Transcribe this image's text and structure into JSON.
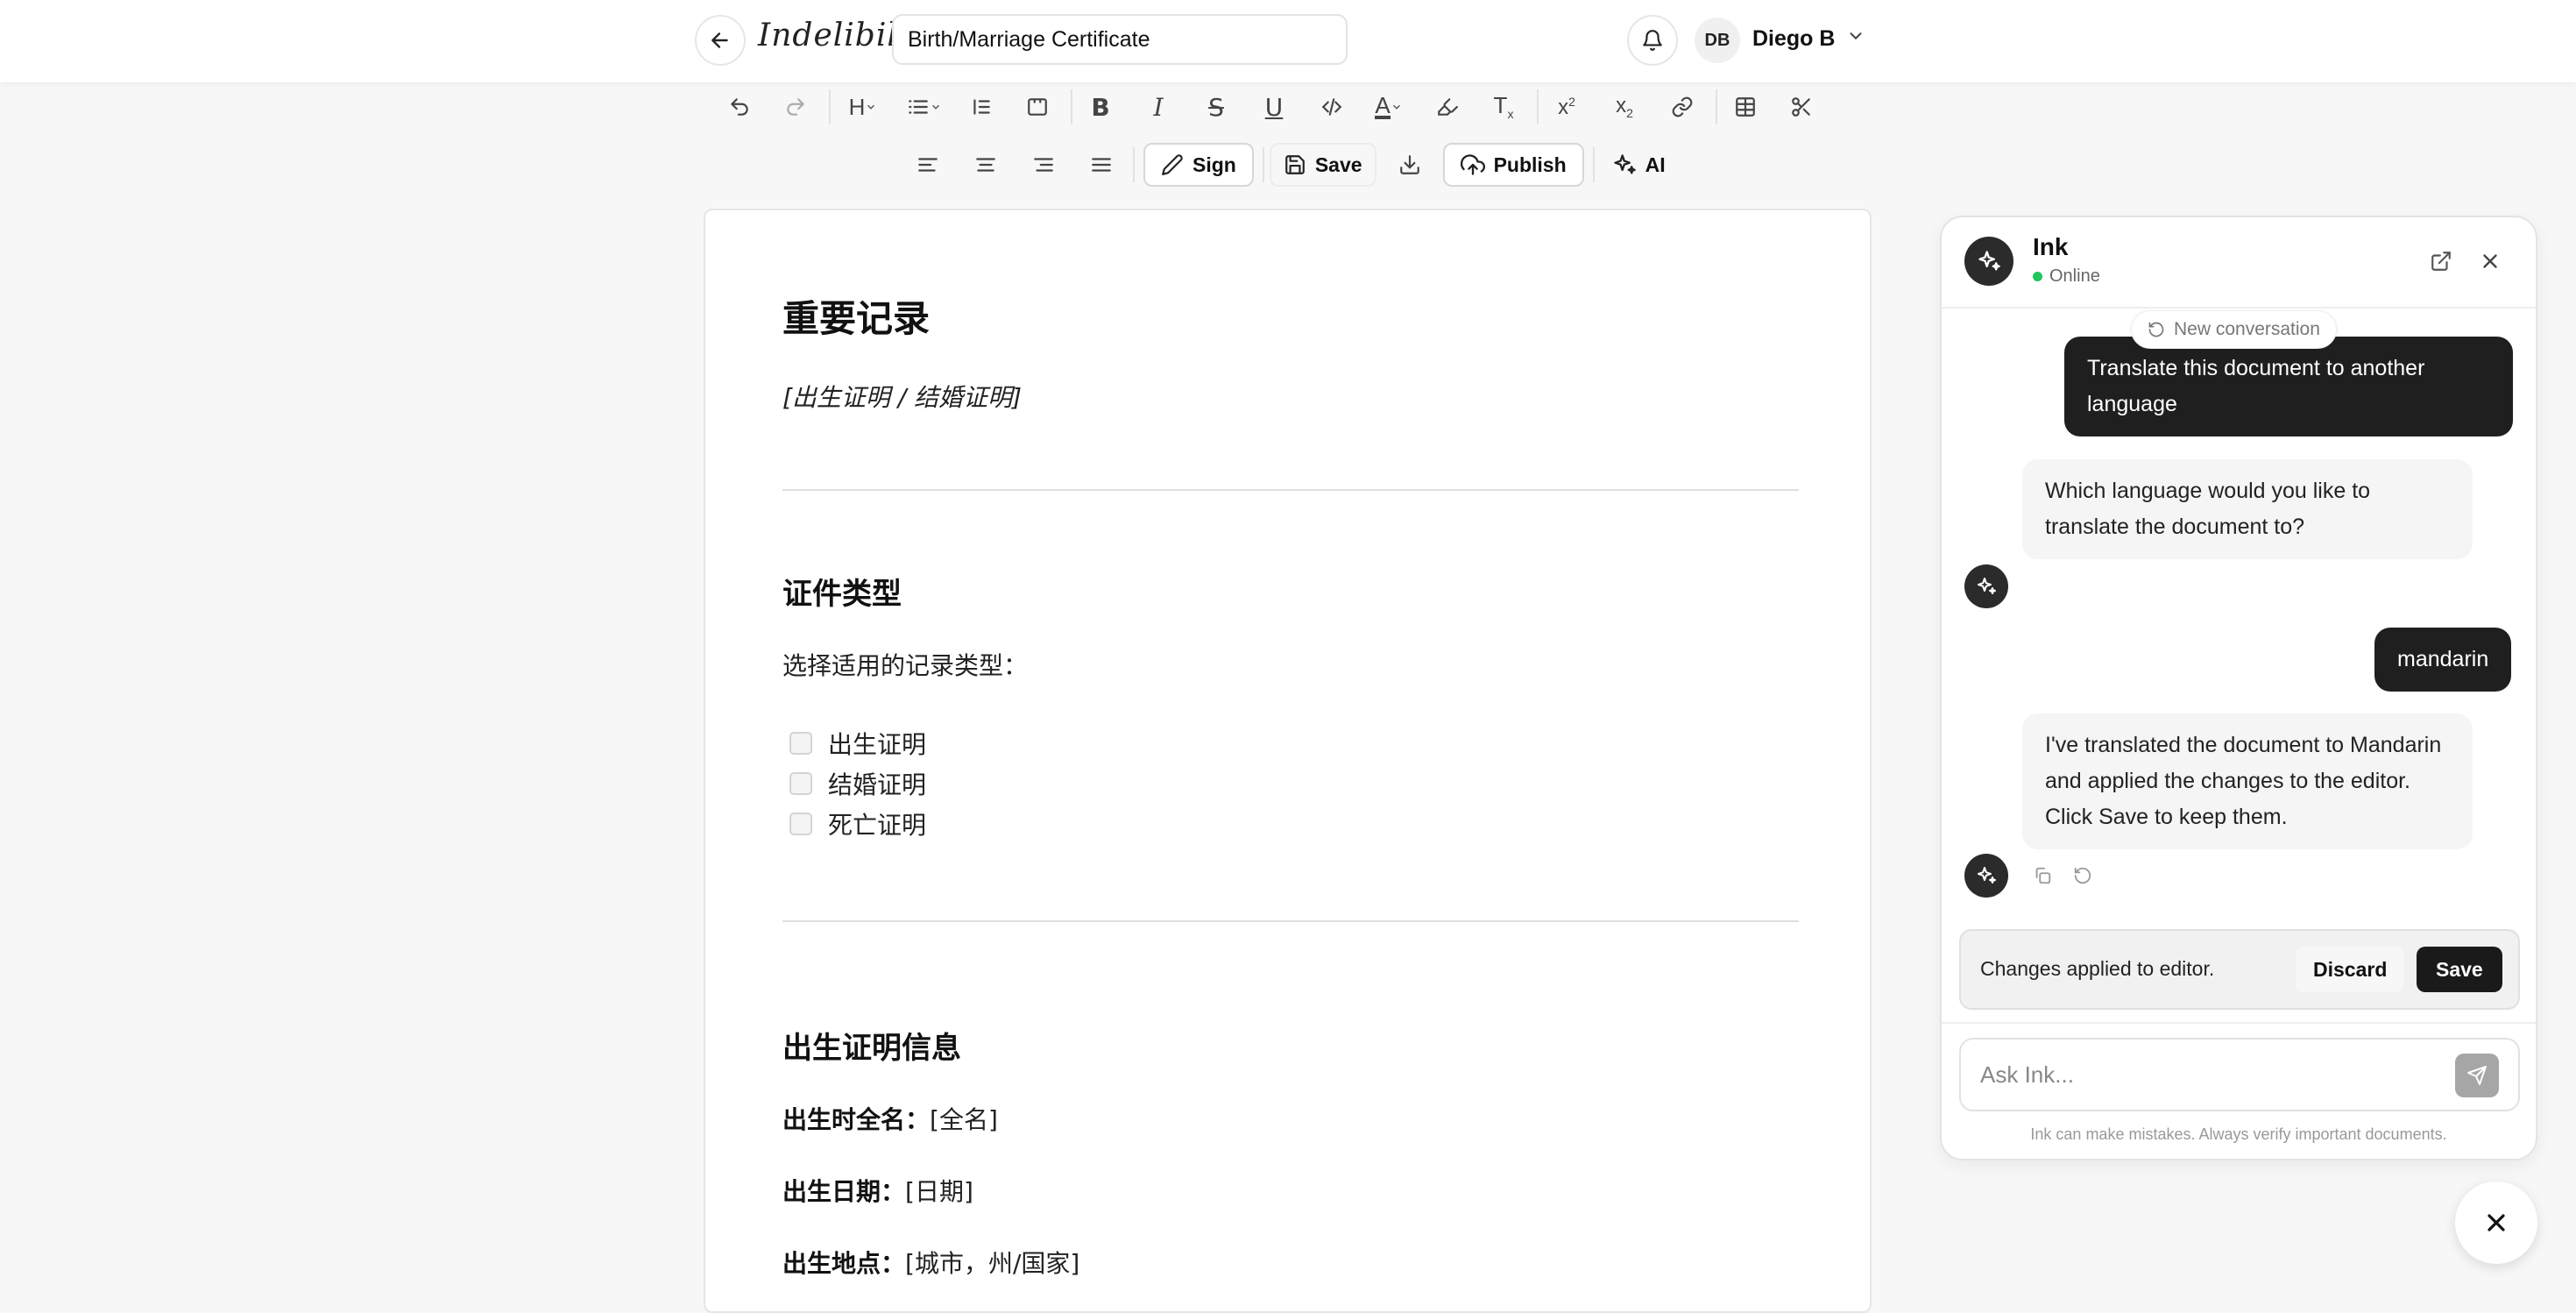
{
  "header": {
    "logo": "Indelibile.",
    "doc_title": "Birth/Marriage Certificate",
    "user_initials": "DB",
    "user_name": "Diego B"
  },
  "toolbar": {
    "row1_icons": [
      "undo-icon",
      "redo-icon",
      "heading-icon",
      "list-icon",
      "blockquote-icon",
      "code-block-icon",
      "bold-icon",
      "italic-icon",
      "strikethrough-icon",
      "underline-icon",
      "code-icon",
      "text-color-icon",
      "highlight-icon",
      "clear-format-icon",
      "superscript-icon",
      "subscript-icon",
      "link-icon",
      "table-icon",
      "scissors-icon"
    ],
    "sign_label": "Sign",
    "save_label": "Save",
    "publish_label": "Publish",
    "ai_label": "AI"
  },
  "document": {
    "title": "重要记录",
    "subtitle": "[出生证明 / 结婚证明]",
    "section1_heading": "证件类型",
    "section1_prompt": "选择适用的记录类型：",
    "checkboxes": [
      "出生证明",
      "结婚证明",
      "死亡证明"
    ],
    "section2_heading": "出生证明信息",
    "fields": [
      {
        "label": "出生时全名：",
        "value": "[全名]"
      },
      {
        "label": "出生日期：",
        "value": "[日期]"
      },
      {
        "label": "出生地点：",
        "value": "[城市，州/国家]"
      }
    ]
  },
  "chat": {
    "name": "Ink",
    "status": "Online",
    "new_conversation": "New conversation",
    "messages": [
      {
        "role": "user",
        "text": "Translate this document to another language"
      },
      {
        "role": "assistant",
        "text": "Which language would you like to translate the document to?"
      },
      {
        "role": "user",
        "text": "mandarin"
      },
      {
        "role": "assistant",
        "text": "I've translated the document to Mandarin and applied the changes to the editor. Click Save to keep them."
      }
    ],
    "changes_text": "Changes applied to editor.",
    "discard_label": "Discard",
    "save_label": "Save",
    "input_placeholder": "Ask Ink...",
    "disclaimer": "Ink can make mistakes. Always verify important documents."
  },
  "colors": {
    "online": "#22c55e",
    "dark": "#1a1a1a"
  }
}
